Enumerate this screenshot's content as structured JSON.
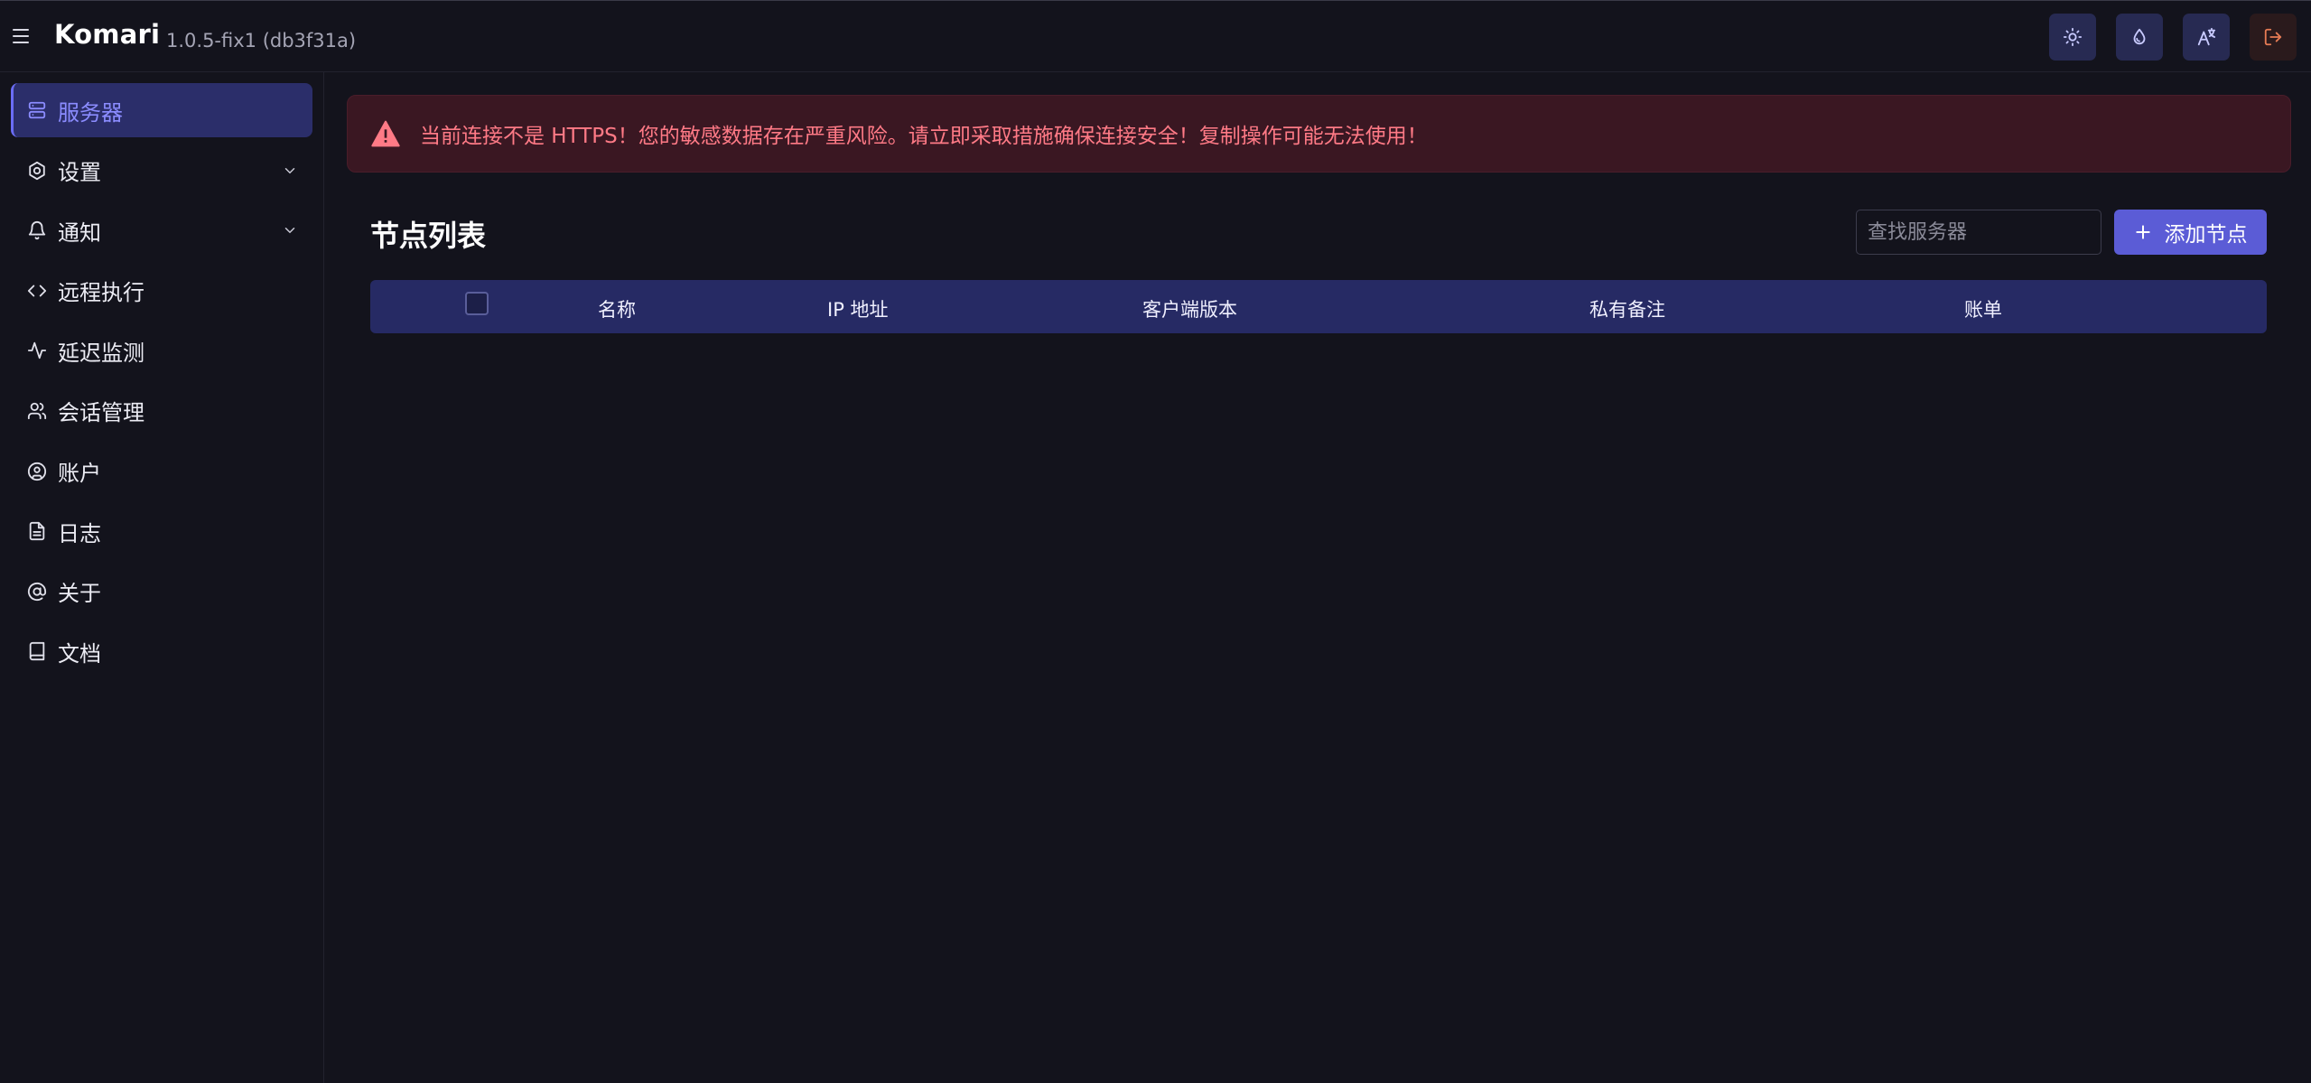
{
  "header": {
    "brand": "Komari",
    "version": "1.0.5-fix1 (db3f31a)",
    "actions": [
      {
        "name": "theme-toggle-button",
        "icon": "sun-icon"
      },
      {
        "name": "color-theme-button",
        "icon": "droplet-icon"
      },
      {
        "name": "language-button",
        "icon": "translate-icon"
      },
      {
        "name": "logout-button",
        "icon": "logout-icon"
      }
    ]
  },
  "sidebar": {
    "items": [
      {
        "label": "服务器",
        "icon": "server-icon",
        "active": true
      },
      {
        "label": "设置",
        "icon": "settings-icon",
        "expandable": true
      },
      {
        "label": "通知",
        "icon": "bell-icon",
        "expandable": true
      },
      {
        "label": "远程执行",
        "icon": "code-icon"
      },
      {
        "label": "延迟监测",
        "icon": "activity-icon"
      },
      {
        "label": "会话管理",
        "icon": "users-icon"
      },
      {
        "label": "账户",
        "icon": "user-circle-icon"
      },
      {
        "label": "日志",
        "icon": "file-text-icon"
      },
      {
        "label": "关于",
        "icon": "at-sign-icon"
      },
      {
        "label": "文档",
        "icon": "book-icon"
      }
    ]
  },
  "alert": {
    "text": "当前连接不是 HTTPS！您的敏感数据存在严重风险。请立即采取措施确保连接安全！复制操作可能无法使用！",
    "icon": "warning-triangle-icon"
  },
  "main": {
    "title": "节点列表",
    "search": {
      "placeholder": "查找服务器",
      "value": ""
    },
    "add_label": "添加节点",
    "table": {
      "columns": [
        "名称",
        "IP 地址",
        "客户端版本",
        "私有备注",
        "账单"
      ],
      "rows": []
    }
  },
  "colors": {
    "background": "#13131c",
    "accent": "#5b5cd6",
    "active_nav_bg": "#2b2e6a",
    "alert_bg": "#3a1722",
    "alert_text": "#ff7a86",
    "table_header_bg": "#262a64"
  }
}
